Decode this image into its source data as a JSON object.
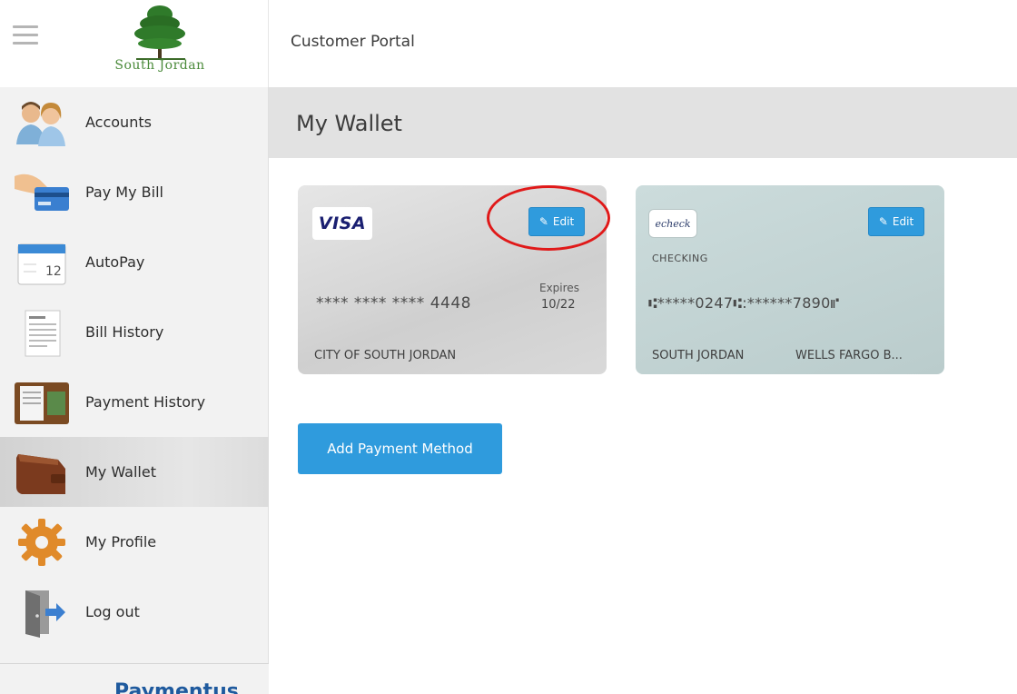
{
  "header": {
    "title": "Customer Portal"
  },
  "logo": {
    "text": "South Jordan",
    "icon": "tree-icon"
  },
  "sidebar": {
    "items": [
      {
        "label": "Accounts",
        "icon": "people-icon"
      },
      {
        "label": "Pay My Bill",
        "icon": "card-payment-icon"
      },
      {
        "label": "AutoPay",
        "icon": "calendar-icon"
      },
      {
        "label": "Bill History",
        "icon": "invoice-icon"
      },
      {
        "label": "Payment History",
        "icon": "wallet-folder-icon"
      },
      {
        "label": "My Wallet",
        "icon": "wallet-icon",
        "active": true
      },
      {
        "label": "My Profile",
        "icon": "gear-icon"
      },
      {
        "label": "Log out",
        "icon": "door-icon"
      }
    ],
    "bottom_text": "Paymentus"
  },
  "page": {
    "title": "My Wallet"
  },
  "cards": {
    "visa": {
      "brand": "VISA",
      "edit_label": "Edit",
      "number": "**** **** **** 4448",
      "expires_label": "Expires",
      "expires_value": "10/22",
      "holder": "CITY OF SOUTH JORDAN"
    },
    "echeck": {
      "brand": "echeck",
      "edit_label": "Edit",
      "account_type": "CHECKING",
      "account_number": "⑆*****0247⑆:******7890⑈",
      "city": "SOUTH JORDAN",
      "bank": "WELLS FARGO B..."
    }
  },
  "actions": {
    "add_payment_label": "Add Payment Method"
  },
  "colors": {
    "accent": "#2f9bdd",
    "highlight": "#e01919"
  }
}
